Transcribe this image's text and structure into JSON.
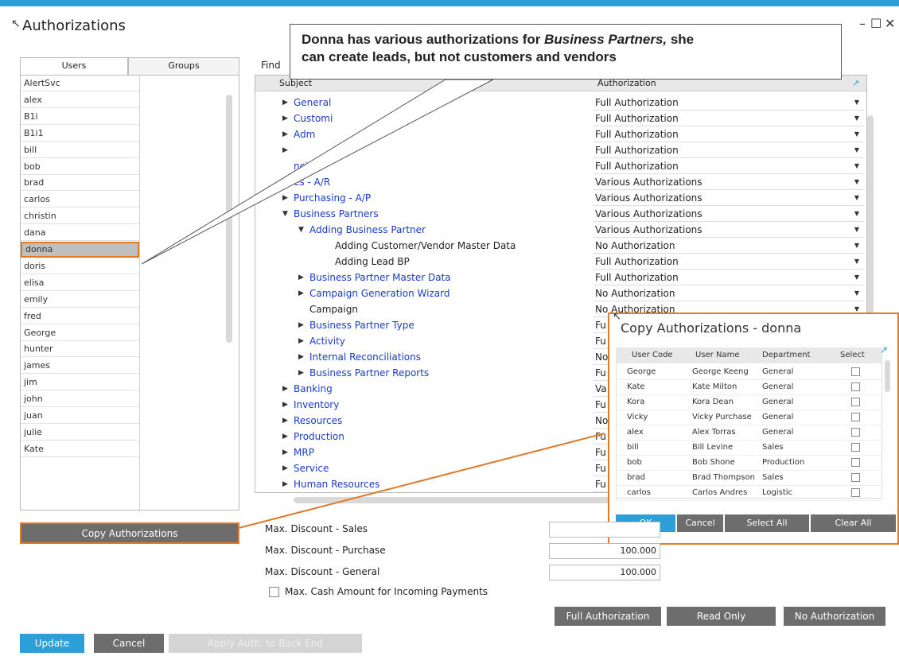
{
  "window": {
    "title": "Authorizations",
    "minimize": "–",
    "maximize": "☐",
    "close": "✕"
  },
  "tabs": {
    "users": "Users",
    "groups": "Groups"
  },
  "users": [
    "AlertSvc",
    "alex",
    "B1i",
    "B1i1",
    "bill",
    "bob",
    "brad",
    "carlos",
    "christin",
    "dana",
    "donna",
    "doris",
    "elisa",
    "emily",
    "fred",
    "George",
    "hunter",
    "james",
    "jim",
    "john",
    "juan",
    "julie",
    "Kate"
  ],
  "selected_user": "donna",
  "copy_auth_button": "Copy Authorizations",
  "find_label": "Find",
  "subject_header": "Subject",
  "authorization_header": "Authorization",
  "expand_icon": "↗",
  "subjects": [
    {
      "label": "General",
      "auth": "Full Authorization",
      "level": 0,
      "arrow": "▶",
      "blue": true
    },
    {
      "label": "Customi",
      "auth": "Full Authorization",
      "level": 0,
      "arrow": "▶",
      "blue": true
    },
    {
      "label": "Adm",
      "auth": "Full Authorization",
      "level": 0,
      "arrow": "▶",
      "blue": true
    },
    {
      "label": "",
      "auth": "Full Authorization",
      "level": 0,
      "arrow": "▶",
      "blue": true
    },
    {
      "label": "ncials",
      "auth": "Full Authorization",
      "level": 0,
      "arrow": "",
      "blue": true
    },
    {
      "label": "es - A/R",
      "auth": "Various Authorizations",
      "level": 0,
      "arrow": "",
      "blue": true
    },
    {
      "label": "Purchasing - A/P",
      "auth": "Various Authorizations",
      "level": 0,
      "arrow": "▶",
      "blue": true
    },
    {
      "label": "Business Partners",
      "auth": "Various Authorizations",
      "level": 0,
      "arrow": "▼",
      "blue": true
    },
    {
      "label": "Adding Business Partner",
      "auth": "Various Authorizations",
      "level": 1,
      "arrow": "▼",
      "blue": true
    },
    {
      "label": "Adding Customer/Vendor Master Data",
      "auth": "No Authorization",
      "level": 2,
      "arrow": "",
      "blue": false
    },
    {
      "label": "Adding Lead BP",
      "auth": "Full Authorization",
      "level": 2,
      "arrow": "",
      "blue": false
    },
    {
      "label": "Business Partner Master Data",
      "auth": "Full Authorization",
      "level": 1,
      "arrow": "▶",
      "blue": true
    },
    {
      "label": "Campaign Generation Wizard",
      "auth": "No Authorization",
      "level": 1,
      "arrow": "▶",
      "blue": true
    },
    {
      "label": "Campaign",
      "auth": "No Authorization",
      "level": 1,
      "arrow": "",
      "blue": false
    },
    {
      "label": "Business Partner Type",
      "auth": "Fu",
      "level": 1,
      "arrow": "▶",
      "blue": true
    },
    {
      "label": "Activity",
      "auth": "Fu",
      "level": 1,
      "arrow": "▶",
      "blue": true
    },
    {
      "label": "Internal Reconciliations",
      "auth": "No",
      "level": 1,
      "arrow": "▶",
      "blue": true
    },
    {
      "label": "Business Partner Reports",
      "auth": "Fu",
      "level": 1,
      "arrow": "▶",
      "blue": true
    },
    {
      "label": "Banking",
      "auth": "Va",
      "level": 0,
      "arrow": "▶",
      "blue": true
    },
    {
      "label": "Inventory",
      "auth": "Fu",
      "level": 0,
      "arrow": "▶",
      "blue": true
    },
    {
      "label": "Resources",
      "auth": "No",
      "level": 0,
      "arrow": "▶",
      "blue": true
    },
    {
      "label": "Production",
      "auth": "Fu",
      "level": 0,
      "arrow": "▶",
      "blue": true
    },
    {
      "label": "MRP",
      "auth": "Fu",
      "level": 0,
      "arrow": "▶",
      "blue": true
    },
    {
      "label": "Service",
      "auth": "Fu",
      "level": 0,
      "arrow": "▶",
      "blue": true
    },
    {
      "label": "Human Resources",
      "auth": "Fu",
      "level": 0,
      "arrow": "▶",
      "blue": true
    }
  ],
  "callout": {
    "line1_a": "Donna has various authorizations for ",
    "line1_em": "Business Partners,",
    "line1_b": " she",
    "line2": "can create leads, but not customers and vendors"
  },
  "copy_dialog": {
    "title": "Copy Authorizations - donna",
    "headers": [
      "User Code",
      "User Name",
      "Department",
      "Select"
    ],
    "rows": [
      [
        "George",
        "George Keeng",
        "General"
      ],
      [
        "Kate",
        "Kate Milton",
        "General"
      ],
      [
        "Kora",
        "Kora Dean",
        "General"
      ],
      [
        "Vicky",
        "Vicky Purchase",
        "General"
      ],
      [
        "alex",
        "Alex Torras",
        "General"
      ],
      [
        "bill",
        "Bill Levine",
        "Sales"
      ],
      [
        "bob",
        "Bob Shone",
        "Production"
      ],
      [
        "brad",
        "Brad Thompson",
        "Sales"
      ],
      [
        "carlos",
        "Carlos Andres",
        "Logistic"
      ]
    ],
    "ok": "OK",
    "cancel": "Cancel",
    "select_all": "Select All",
    "clear_all": "Clear All"
  },
  "discounts": [
    {
      "label": "Max. Discount - Sales",
      "value": ""
    },
    {
      "label": "Max. Discount - Purchase",
      "value": "100.000"
    },
    {
      "label": "Max. Discount - General",
      "value": "100.000"
    }
  ],
  "max_cash_label": "Max. Cash Amount for Incoming Payments",
  "action_buttons": {
    "full": "Full Authorization",
    "read_only": "Read Only",
    "none": "No Authorization"
  },
  "footer": {
    "update": "Update",
    "cancel": "Cancel",
    "apply": "Apply Auth. to Back End"
  },
  "colors": {
    "accent": "#2b9fd6",
    "highlight": "#e07b2a",
    "button_gray": "#6d6d6d",
    "link_blue": "#1a3cc7"
  }
}
